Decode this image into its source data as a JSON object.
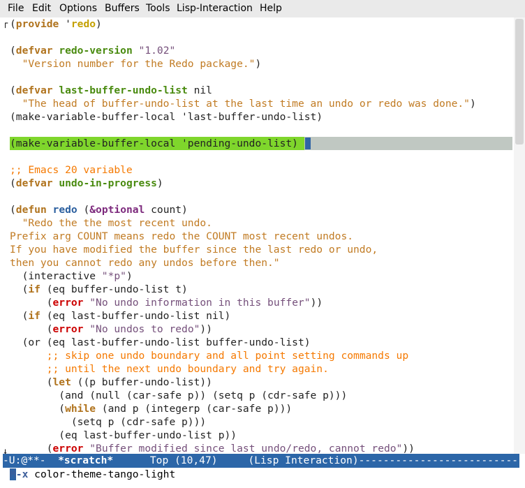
{
  "menu": [
    "File",
    "Edit",
    "Options",
    "Buffers",
    "Tools",
    "Lisp-Interaction",
    "Help"
  ],
  "code_lines": [
    [
      [
        "p",
        "("
      ],
      [
        "kw",
        "provide"
      ],
      [
        "p",
        " '"
      ],
      [
        "const",
        "redo"
      ],
      [
        "p",
        ")"
      ]
    ],
    [],
    [
      [
        "p",
        "("
      ],
      [
        "kw",
        "defvar"
      ],
      [
        "p",
        " "
      ],
      [
        "fn",
        "redo-version"
      ],
      [
        "p",
        " "
      ],
      [
        "str2",
        "\"1.02\""
      ]
    ],
    [
      [
        "p",
        "  "
      ],
      [
        "str",
        "\"Version number for the Redo package.\""
      ],
      [
        "p",
        ")"
      ]
    ],
    [],
    [
      [
        "p",
        "("
      ],
      [
        "kw",
        "defvar"
      ],
      [
        "p",
        " "
      ],
      [
        "fn",
        "last-buffer-undo-list"
      ],
      [
        "p",
        " nil"
      ]
    ],
    [
      [
        "p",
        "  "
      ],
      [
        "str",
        "\"The head of buffer-undo-list at the last time an undo or redo was done.\""
      ],
      [
        "p",
        ")"
      ]
    ],
    [
      [
        "p",
        "(make-variable-buffer-local 'last-buffer-undo-list)"
      ]
    ],
    [],
    [
      [
        "p",
        "(make-variable-buffer-local 'pending-undo-list)"
      ]
    ],
    [],
    [
      [
        "cmt",
        ";; Emacs 20 variable"
      ]
    ],
    [
      [
        "p",
        "("
      ],
      [
        "kw",
        "defvar"
      ],
      [
        "p",
        " "
      ],
      [
        "fn",
        "undo-in-progress"
      ],
      [
        "p",
        ")"
      ]
    ],
    [],
    [
      [
        "p",
        "("
      ],
      [
        "kw",
        "defun"
      ],
      [
        "p",
        " "
      ],
      [
        "fn2",
        "redo"
      ],
      [
        "p",
        " ("
      ],
      [
        "kw2",
        "&optional"
      ],
      [
        "p",
        " count)"
      ]
    ],
    [
      [
        "str",
        "  \"Redo the the most recent undo."
      ]
    ],
    [
      [
        "str",
        "Prefix arg COUNT means redo the COUNT most recent undos."
      ]
    ],
    [
      [
        "str",
        "If you have modified the buffer since the last redo or undo,"
      ]
    ],
    [
      [
        "str",
        "then you cannot redo any undos before then.\""
      ]
    ],
    [
      [
        "p",
        "  (interactive "
      ],
      [
        "str2",
        "\"*p\""
      ],
      [
        "p",
        ")"
      ]
    ],
    [
      [
        "p",
        "  ("
      ],
      [
        "kw",
        "if"
      ],
      [
        "p",
        " (eq buffer-undo-list t)"
      ]
    ],
    [
      [
        "p",
        "      ("
      ],
      [
        "err",
        "error"
      ],
      [
        "p",
        " "
      ],
      [
        "str2",
        "\"No undo information in this buffer\""
      ],
      [
        "p",
        "))"
      ]
    ],
    [
      [
        "p",
        "  ("
      ],
      [
        "kw",
        "if"
      ],
      [
        "p",
        " (eq last-buffer-undo-list nil)"
      ]
    ],
    [
      [
        "p",
        "      ("
      ],
      [
        "err",
        "error"
      ],
      [
        "p",
        " "
      ],
      [
        "str2",
        "\"No undos to redo\""
      ],
      [
        "p",
        "))"
      ]
    ],
    [
      [
        "p",
        "  (or (eq last-buffer-undo-list buffer-undo-list)"
      ]
    ],
    [
      [
        "p",
        "      "
      ],
      [
        "cmt",
        ";; skip one undo boundary and all point setting commands up"
      ]
    ],
    [
      [
        "p",
        "      "
      ],
      [
        "cmt",
        ";; until the next undo boundary and try again."
      ]
    ],
    [
      [
        "p",
        "      ("
      ],
      [
        "kw",
        "let"
      ],
      [
        "p",
        " ((p buffer-undo-list))"
      ]
    ],
    [
      [
        "p",
        "        (and (null (car-safe p)) (setq p (cdr-safe p)))"
      ]
    ],
    [
      [
        "p",
        "        ("
      ],
      [
        "kw",
        "while"
      ],
      [
        "p",
        " (and p (integerp (car-safe p)))"
      ]
    ],
    [
      [
        "p",
        "          (setq p (cdr-safe p)))"
      ]
    ],
    [
      [
        "p",
        "        (eq last-buffer-undo-list p))"
      ]
    ],
    [
      [
        "p",
        "      ("
      ],
      [
        "err",
        "error"
      ],
      [
        "p",
        " "
      ],
      [
        "str2",
        "\"Buffer modified since last undo/redo, cannot redo\""
      ],
      [
        "p",
        "))"
      ]
    ]
  ],
  "highlight_line": 9,
  "modeline": {
    "status": "-U:@**-  ",
    "buffer": "*scratch*",
    "position": "      Top (10,47)     ",
    "mode": "(Lisp Interaction)",
    "fill": "-----------------------------"
  },
  "minibuffer": {
    "prefix_cursor": "M",
    "prefix_rest": "-x",
    "command": " color-theme-tango-light"
  }
}
